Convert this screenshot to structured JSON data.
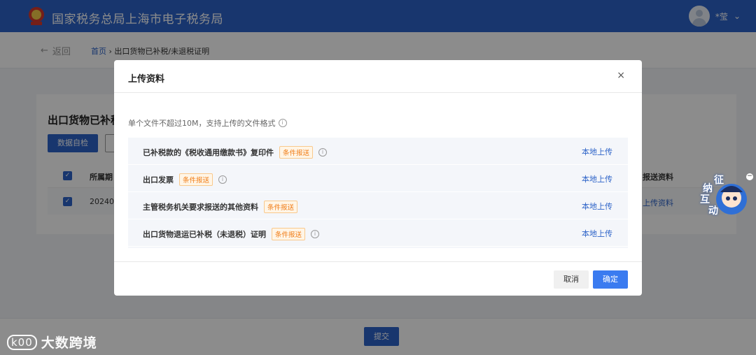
{
  "header": {
    "site_title": "国家税务总局上海市电子税务局",
    "user_name": "*莹",
    "brand_color": "#2d63c8"
  },
  "subbar": {
    "back_label": "返回",
    "breadcrumb_home": "首页",
    "breadcrumb_sep": "›",
    "breadcrumb_current": "出口货物已补税/未退税证明"
  },
  "page": {
    "title": "出口货物已补税",
    "selfcheck_button": "数据自检",
    "table": {
      "headers": {
        "period": "所属期",
        "docs": "报送资料"
      },
      "row": {
        "period": "20240",
        "docs": "上传资料"
      }
    },
    "submit_button": "提交"
  },
  "modal": {
    "title": "上传资料",
    "close_icon": "×",
    "hint": "单个文件不超过10M，支持上传的文件格式",
    "items": [
      {
        "name": "已补税款的《税收通用缴款书》复印件",
        "tag": "条件报送",
        "has_info": true,
        "action": "本地上传"
      },
      {
        "name": "出口发票",
        "tag": "条件报送",
        "has_info": true,
        "action": "本地上传"
      },
      {
        "name": "主管税务机关要求报送的其他资料",
        "tag": "条件报送",
        "has_info": false,
        "action": "本地上传"
      },
      {
        "name": "出口货物退运已补税（未退税）证明",
        "tag": "条件报送",
        "has_info": true,
        "action": "本地上传"
      }
    ],
    "cancel_button": "取消",
    "ok_button": "确定"
  },
  "assistant": {
    "chars": [
      "征",
      "纳",
      "互",
      "动"
    ]
  },
  "watermark": {
    "logo": "k00",
    "text": "大数跨境"
  }
}
